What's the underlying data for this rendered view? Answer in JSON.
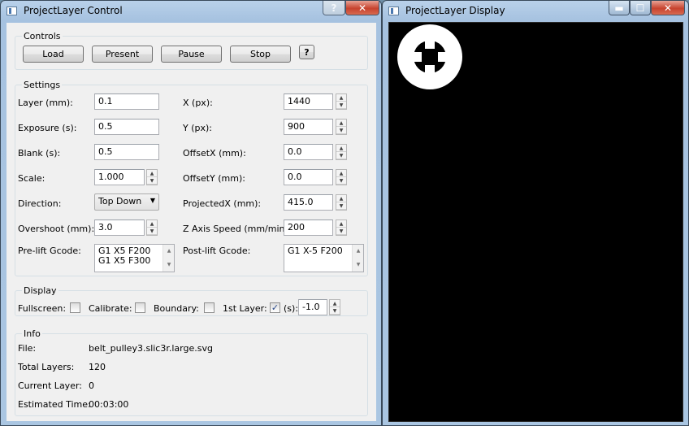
{
  "control_window": {
    "title": "ProjectLayer Control",
    "buttons": {
      "help": "?",
      "close": "✕"
    }
  },
  "controls": {
    "legend": "Controls",
    "load": "Load",
    "present": "Present",
    "pause": "Pause",
    "stop": "Stop",
    "help": "?"
  },
  "settings": {
    "legend": "Settings",
    "layer_label": "Layer (mm):",
    "layer_value": "0.1",
    "exposure_label": "Exposure (s):",
    "exposure_value": "0.5",
    "blank_label": "Blank (s):",
    "blank_value": "0.5",
    "scale_label": "Scale:",
    "scale_value": "1.000",
    "direction_label": "Direction:",
    "direction_value": "Top Down",
    "overshoot_label": "Overshoot (mm):",
    "overshoot_value": "3.0",
    "prelift_label": "Pre-lift Gcode:",
    "prelift_lines": [
      "G1 X5 F200",
      "G1 X5 F300"
    ],
    "x_label": "X (px):",
    "x_value": "1440",
    "y_label": "Y (px):",
    "y_value": "900",
    "offsetx_label": "OffsetX (mm):",
    "offsetx_value": "0.0",
    "offsety_label": "OffsetY (mm):",
    "offsety_value": "0.0",
    "projectedx_label": "ProjectedX (mm):",
    "projectedx_value": "415.0",
    "zspeed_label": "Z Axis Speed (mm/min):",
    "zspeed_value": "200",
    "postlift_label": "Post-lift Gcode:",
    "postlift_lines": [
      "G1 X-5 F200"
    ]
  },
  "display": {
    "legend": "Display",
    "fullscreen_label": "Fullscreen:",
    "fullscreen_checked": false,
    "calibrate_label": "Calibrate:",
    "calibrate_checked": false,
    "boundary_label": "Boundary:",
    "boundary_checked": false,
    "firstlayer_label": "1st Layer:",
    "firstlayer_checked": true,
    "seconds_label": "(s):",
    "seconds_value": "-1.0"
  },
  "info": {
    "legend": "Info",
    "file_label": "File:",
    "file_value": "belt_pulley3.slic3r.large.svg",
    "total_label": "Total Layers:",
    "total_value": "120",
    "current_label": "Current Layer:",
    "current_value": "0",
    "time_label": "Estimated Time:",
    "time_value": "00:03:00"
  },
  "display_window": {
    "title": "ProjectLayer Display",
    "buttons": {
      "minimize": "▬",
      "maximize": "☐",
      "close": "✕"
    }
  },
  "icons": {
    "spin_up": "▲",
    "spin_down": "▼",
    "dropdown": "▼",
    "checkmark": "✓"
  }
}
